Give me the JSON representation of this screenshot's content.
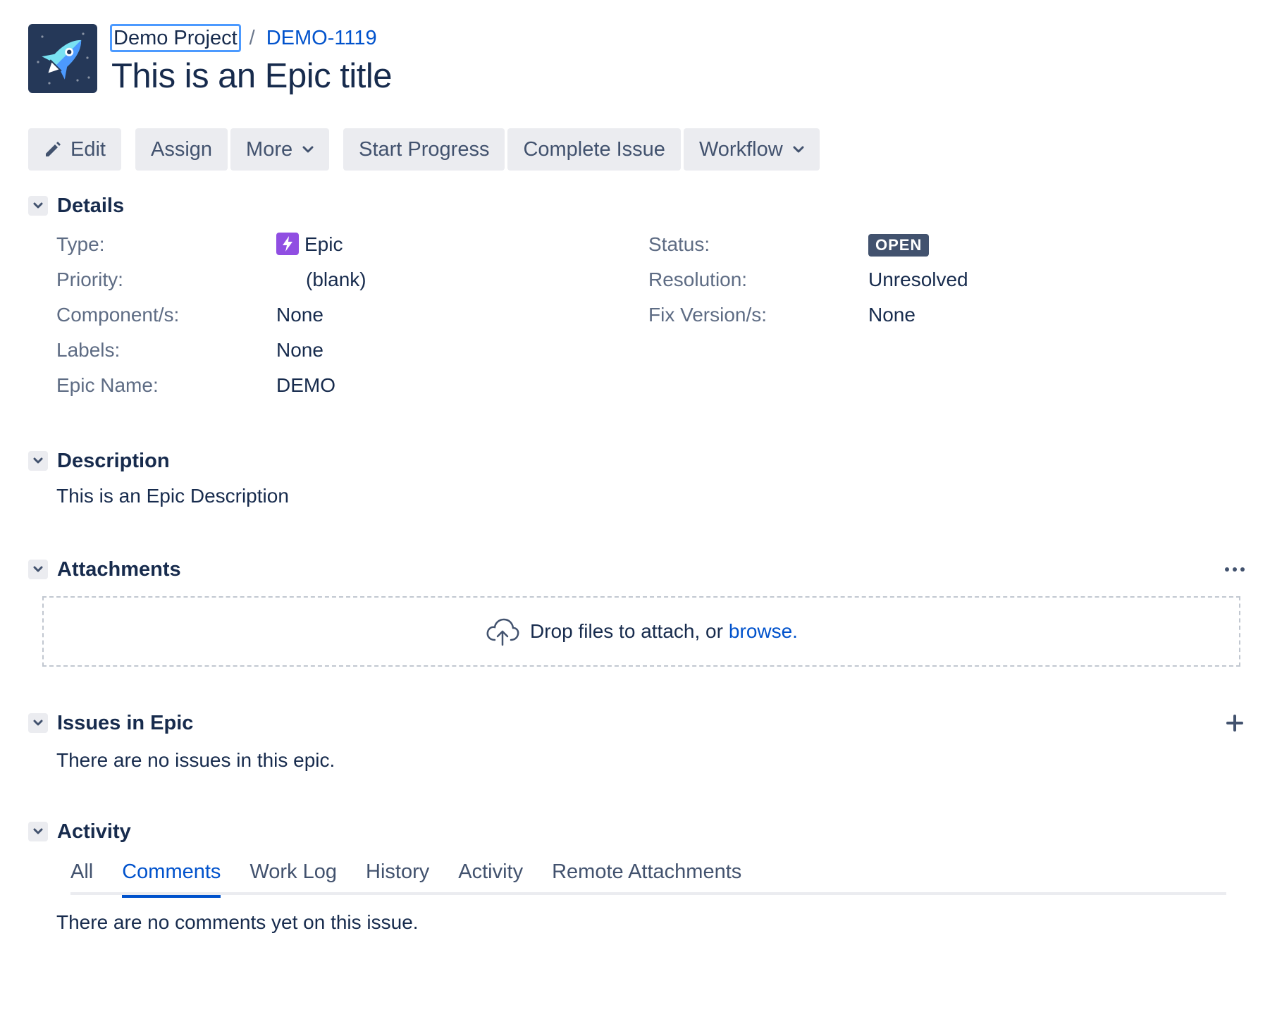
{
  "header": {
    "project_link": "Demo Project",
    "separator": "/",
    "issue_key": "DEMO-1119",
    "title": "This is an Epic title"
  },
  "toolbar": {
    "edit": "Edit",
    "assign": "Assign",
    "more": "More",
    "start_progress": "Start Progress",
    "complete_issue": "Complete Issue",
    "workflow": "Workflow"
  },
  "details": {
    "title": "Details",
    "type_label": "Type:",
    "type_value": "Epic",
    "priority_label": "Priority:",
    "priority_value": "(blank)",
    "components_label": "Component/s:",
    "components_value": "None",
    "labels_label": "Labels:",
    "labels_value": "None",
    "epic_name_label": "Epic Name:",
    "epic_name_value": "DEMO",
    "status_label": "Status:",
    "status_value": "OPEN",
    "resolution_label": "Resolution:",
    "resolution_value": "Unresolved",
    "fix_version_label": "Fix Version/s:",
    "fix_version_value": "None"
  },
  "description": {
    "title": "Description",
    "text": "This is an Epic Description"
  },
  "attachments": {
    "title": "Attachments",
    "drop_text": "Drop files to attach, or",
    "browse_link": "browse."
  },
  "issues_in_epic": {
    "title": "Issues in Epic",
    "empty_text": "There are no issues in this epic."
  },
  "activity": {
    "title": "Activity",
    "tabs": [
      "All",
      "Comments",
      "Work Log",
      "History",
      "Activity",
      "Remote Attachments"
    ],
    "active_tab": "Comments",
    "empty_text": "There are no comments yet on this issue."
  },
  "colors": {
    "link": "#0052cc",
    "button_bg": "#ebecf0",
    "status_badge": "#42526e",
    "epic_icon": "#904ee2"
  }
}
